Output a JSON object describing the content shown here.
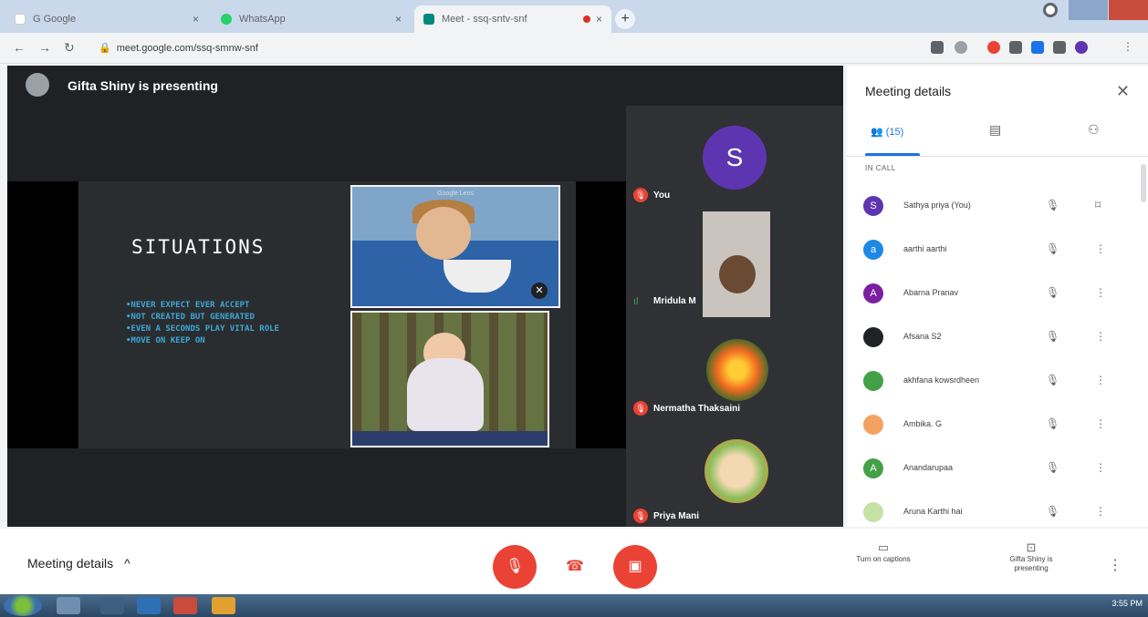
{
  "browser": {
    "tabs": [
      {
        "label": "G  Google",
        "close": "×",
        "color": "#ffffff"
      },
      {
        "label": "WhatsApp",
        "close": "×",
        "color": "#25d366"
      },
      {
        "label": "Meet - ssq-sntv-snf",
        "close": "×",
        "color": "#00897b"
      }
    ],
    "new_tab": "+",
    "address": "meet.google.com/ssq-smnw-snf"
  },
  "stage": {
    "presenting_text": "Gifta Shiny is presenting",
    "slide": {
      "title": "SITUATIONS",
      "bullets": [
        "•NEVER EXPECT EVER ACCEPT",
        "•NOT CREATED BUT GENERATED",
        "•EVEN A SECONDS PLAY VITAL ROLE",
        "•MOVE ON KEEP ON"
      ],
      "photo_caption": "Google Lens"
    },
    "tiles": [
      {
        "name": "You",
        "avatar": "S"
      },
      {
        "name": "Mridula M"
      },
      {
        "name": "Nermatha Thaksaini"
      },
      {
        "name": "Priya Mani"
      }
    ]
  },
  "sidebar": {
    "title": "Meeting details",
    "close": "✕",
    "people_count": "(15)",
    "section": "IN CALL",
    "participants": [
      {
        "name": "Sathya priya (You)",
        "initial": "S",
        "color": "#5e35b1"
      },
      {
        "name": "aarthi aarthi",
        "initial": "a",
        "color": "#1e88e5"
      },
      {
        "name": "Abarna Pranav",
        "initial": "A",
        "color": "#7b1fa2"
      },
      {
        "name": "Afsana S2",
        "initial": "",
        "color": "#202124"
      },
      {
        "name": "akhfana kowsrdheen",
        "initial": "",
        "color": "#43a047"
      },
      {
        "name": "Ambika. G",
        "initial": "",
        "color": "#f4a261"
      },
      {
        "name": "Anandarupaa",
        "initial": "A",
        "color": "#43a047"
      },
      {
        "name": "Aruna Karthi hai",
        "initial": "",
        "color": "#c5e1a5"
      }
    ]
  },
  "controls": {
    "meeting_details": "Meeting details",
    "chevron": "^",
    "captions": "Turn on captions",
    "presenting": "Gifta Shiny is presenting"
  },
  "taskbar": {
    "time": "3:55 PM"
  }
}
